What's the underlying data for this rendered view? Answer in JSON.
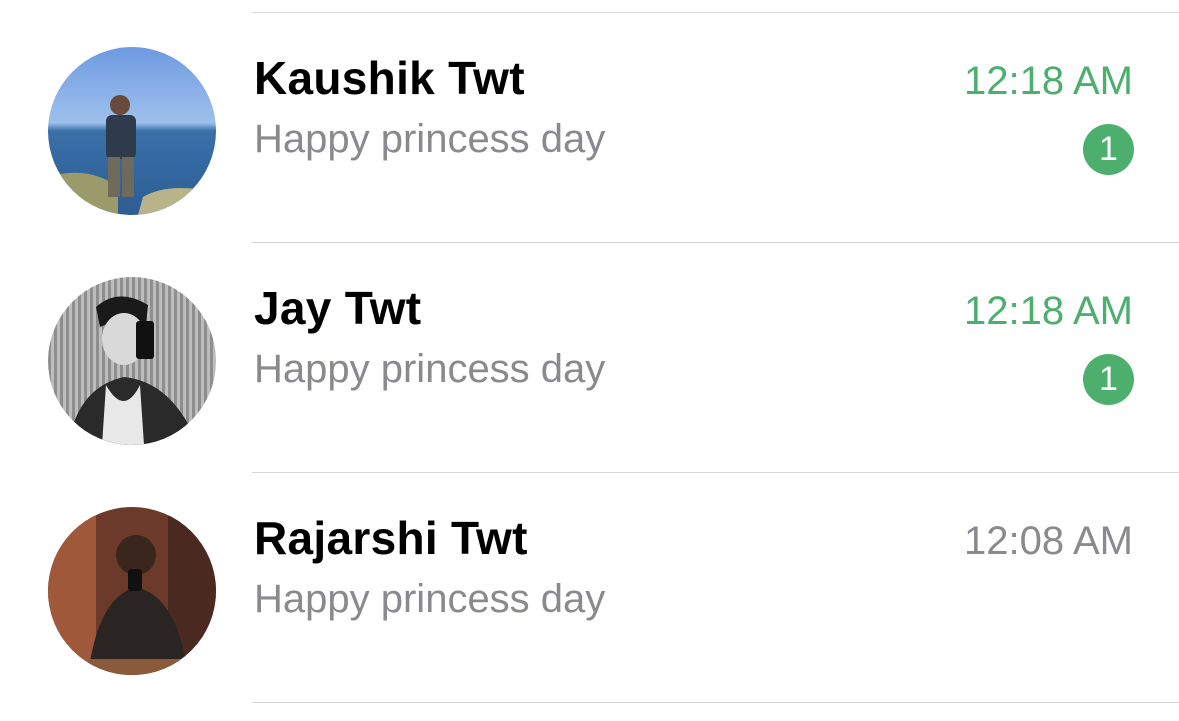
{
  "chats": [
    {
      "name": "Kaushik Twt",
      "preview": "Happy princess day",
      "time": "12:18 AM",
      "unread_count": "1",
      "unread": true
    },
    {
      "name": "Jay Twt",
      "preview": "Happy princess day",
      "time": "12:18 AM",
      "unread_count": "1",
      "unread": true
    },
    {
      "name": "Rajarshi Twt",
      "preview": "Happy princess day",
      "time": "12:08 AM",
      "unread": false
    }
  ],
  "colors": {
    "accent_green": "#4caf6e",
    "secondary_text": "#8a8a8e",
    "divider": "#d6d6d9"
  }
}
